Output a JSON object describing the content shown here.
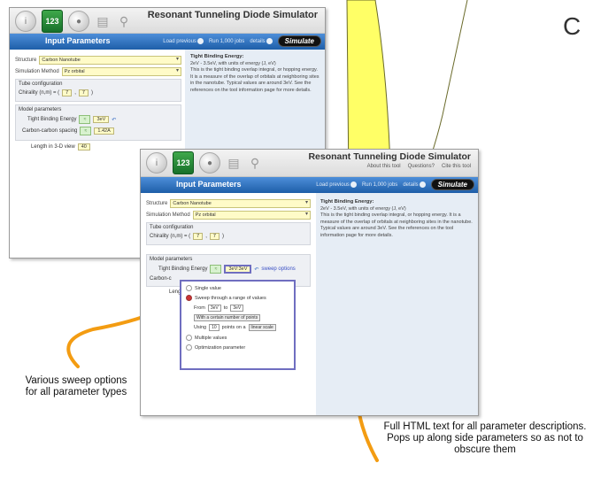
{
  "slide": {
    "corner_letter": "C"
  },
  "colors": {
    "note": "#ffff66",
    "arrow": "#f39c12",
    "bar": "#2f73c2",
    "field": "#fffbc8"
  },
  "window1": {
    "title": "Resonant Tunneling Diode Simulator",
    "bar_title": "Input Parameters",
    "bar_actions": [
      "Load previous",
      "Run 1,000 jobs",
      "details"
    ],
    "simulate_label": "Simulate",
    "structure_label": "Structure",
    "structure_value": "Carbon Nanotube",
    "method_label": "Simulation Method",
    "method_value": "Pz orbital",
    "tube_group": "Tube configuration",
    "chirality_label": "Chirality (n,m) = (",
    "chirality_n": "7",
    "chirality_m": "7",
    "model_group": "Model parameters",
    "tb_label": "Tight Binding Energy",
    "tb_value": "3eV",
    "cc_label": "Carbon-carbon spacing",
    "cc_value": "1.42A",
    "length_label": "Length in 3-D view",
    "length_value": "40",
    "desc_title": "Tight Binding Energy:",
    "desc_units": "2eV - 3.5eV, with units of energy (J, eV)",
    "desc_body": "This is the tight binding overlap integral, or hopping energy. It is a measure of the overlap of orbitals at neighboring sites in the nanotube. Typical values are around 3eV. See the references on the tool information page for more details."
  },
  "window2": {
    "title": "Resonant Tunneling Diode Simulator",
    "links": [
      "About this tool",
      "Questions?",
      "Cite this tool"
    ],
    "bar_title": "Input Parameters",
    "bar_actions": [
      "Load previous",
      "Run 1,000 jobs",
      "details"
    ],
    "simulate_label": "Simulate",
    "structure_label": "Structure",
    "structure_value": "Carbon Nanotube",
    "method_label": "Simulation Method",
    "method_value": "Pz orbital",
    "tube_group": "Tube configuration",
    "chirality_label": "Chirality (n,m) = (",
    "chirality_n": "7",
    "chirality_m": "7",
    "model_group": "Model parameters",
    "tb_label": "Tight Binding Energy",
    "tb_value": "3eV:3eV",
    "sweep_link": "sweep options",
    "cc_stub": "Carbon-c",
    "len_stub": "Leng",
    "popup": {
      "single": "Single value",
      "sweep": "Sweep through a range of values",
      "from_label": "From",
      "from_value": "3eV",
      "to_label": "to",
      "to_value": "3eV",
      "mode": "With a certain number of points",
      "using_label": "Using",
      "using_value": "10",
      "points_label": "points on a",
      "scale": "linear scale",
      "multiple": "Multiple values",
      "optimization": "Optimization parameter"
    },
    "desc_title": "Tight Binding Energy:",
    "desc_units": "2eV - 3.5eV, with units of energy (J, eV)",
    "desc_body": "This is the tight binding overlap integral, or hopping energy. It is a measure of the overlap of orbitals at neighboring sites in the nanotube. Typical values are around 3eV. See the references on the tool information page for more details."
  },
  "captions": {
    "left": "Various sweep options for all parameter types",
    "right": "Full HTML text for all parameter descriptions.  Pops up along side parameters so as not to obscure them"
  }
}
